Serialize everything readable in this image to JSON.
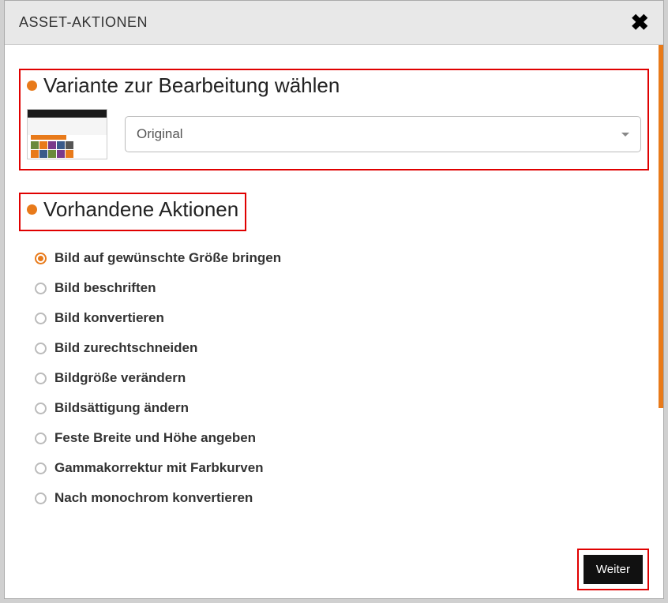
{
  "modal": {
    "title": "ASSET-AKTIONEN"
  },
  "section1": {
    "heading": "Variante zur Bearbeitung wählen",
    "select_value": "Original"
  },
  "section2": {
    "heading": "Vorhandene Aktionen"
  },
  "actions": [
    {
      "label": "Bild auf gewünschte Größe bringen",
      "selected": true
    },
    {
      "label": "Bild beschriften",
      "selected": false
    },
    {
      "label": "Bild konvertieren",
      "selected": false
    },
    {
      "label": "Bild zurechtschneiden",
      "selected": false
    },
    {
      "label": "Bildgröße verändern",
      "selected": false
    },
    {
      "label": "Bildsättigung ändern",
      "selected": false
    },
    {
      "label": "Feste Breite und Höhe angeben",
      "selected": false
    },
    {
      "label": "Gammakorrektur mit Farbkurven",
      "selected": false
    },
    {
      "label": "Nach monochrom konvertieren",
      "selected": false
    }
  ],
  "footer": {
    "next_label": "Weiter"
  }
}
